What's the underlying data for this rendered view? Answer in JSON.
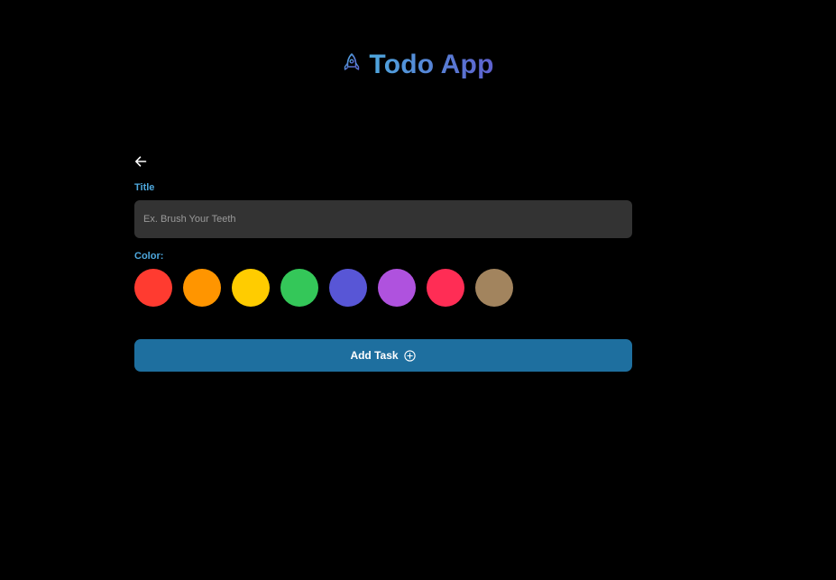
{
  "header": {
    "logo_icon": "rocket-icon",
    "title": "Todo App",
    "gradient_start": "#4EA8DE",
    "gradient_end": "#5E60CE"
  },
  "form": {
    "back_icon": "arrow-left-icon",
    "title_label": "Title",
    "title_value": "",
    "title_placeholder": "Ex. Brush Your Teeth",
    "color_label": "Color:",
    "colors": [
      {
        "name": "red",
        "hex": "#FF3B30"
      },
      {
        "name": "orange",
        "hex": "#FF9500"
      },
      {
        "name": "yellow",
        "hex": "#FFCC00"
      },
      {
        "name": "green",
        "hex": "#34C759"
      },
      {
        "name": "indigo",
        "hex": "#5856D6"
      },
      {
        "name": "purple",
        "hex": "#AF52DE"
      },
      {
        "name": "pink",
        "hex": "#FF2D55"
      },
      {
        "name": "brown",
        "hex": "#A2845E"
      }
    ],
    "submit_label": "Add Task",
    "submit_icon": "plus-circle-icon",
    "submit_color": "#1E6F9F",
    "label_color": "#4EA8DE"
  }
}
